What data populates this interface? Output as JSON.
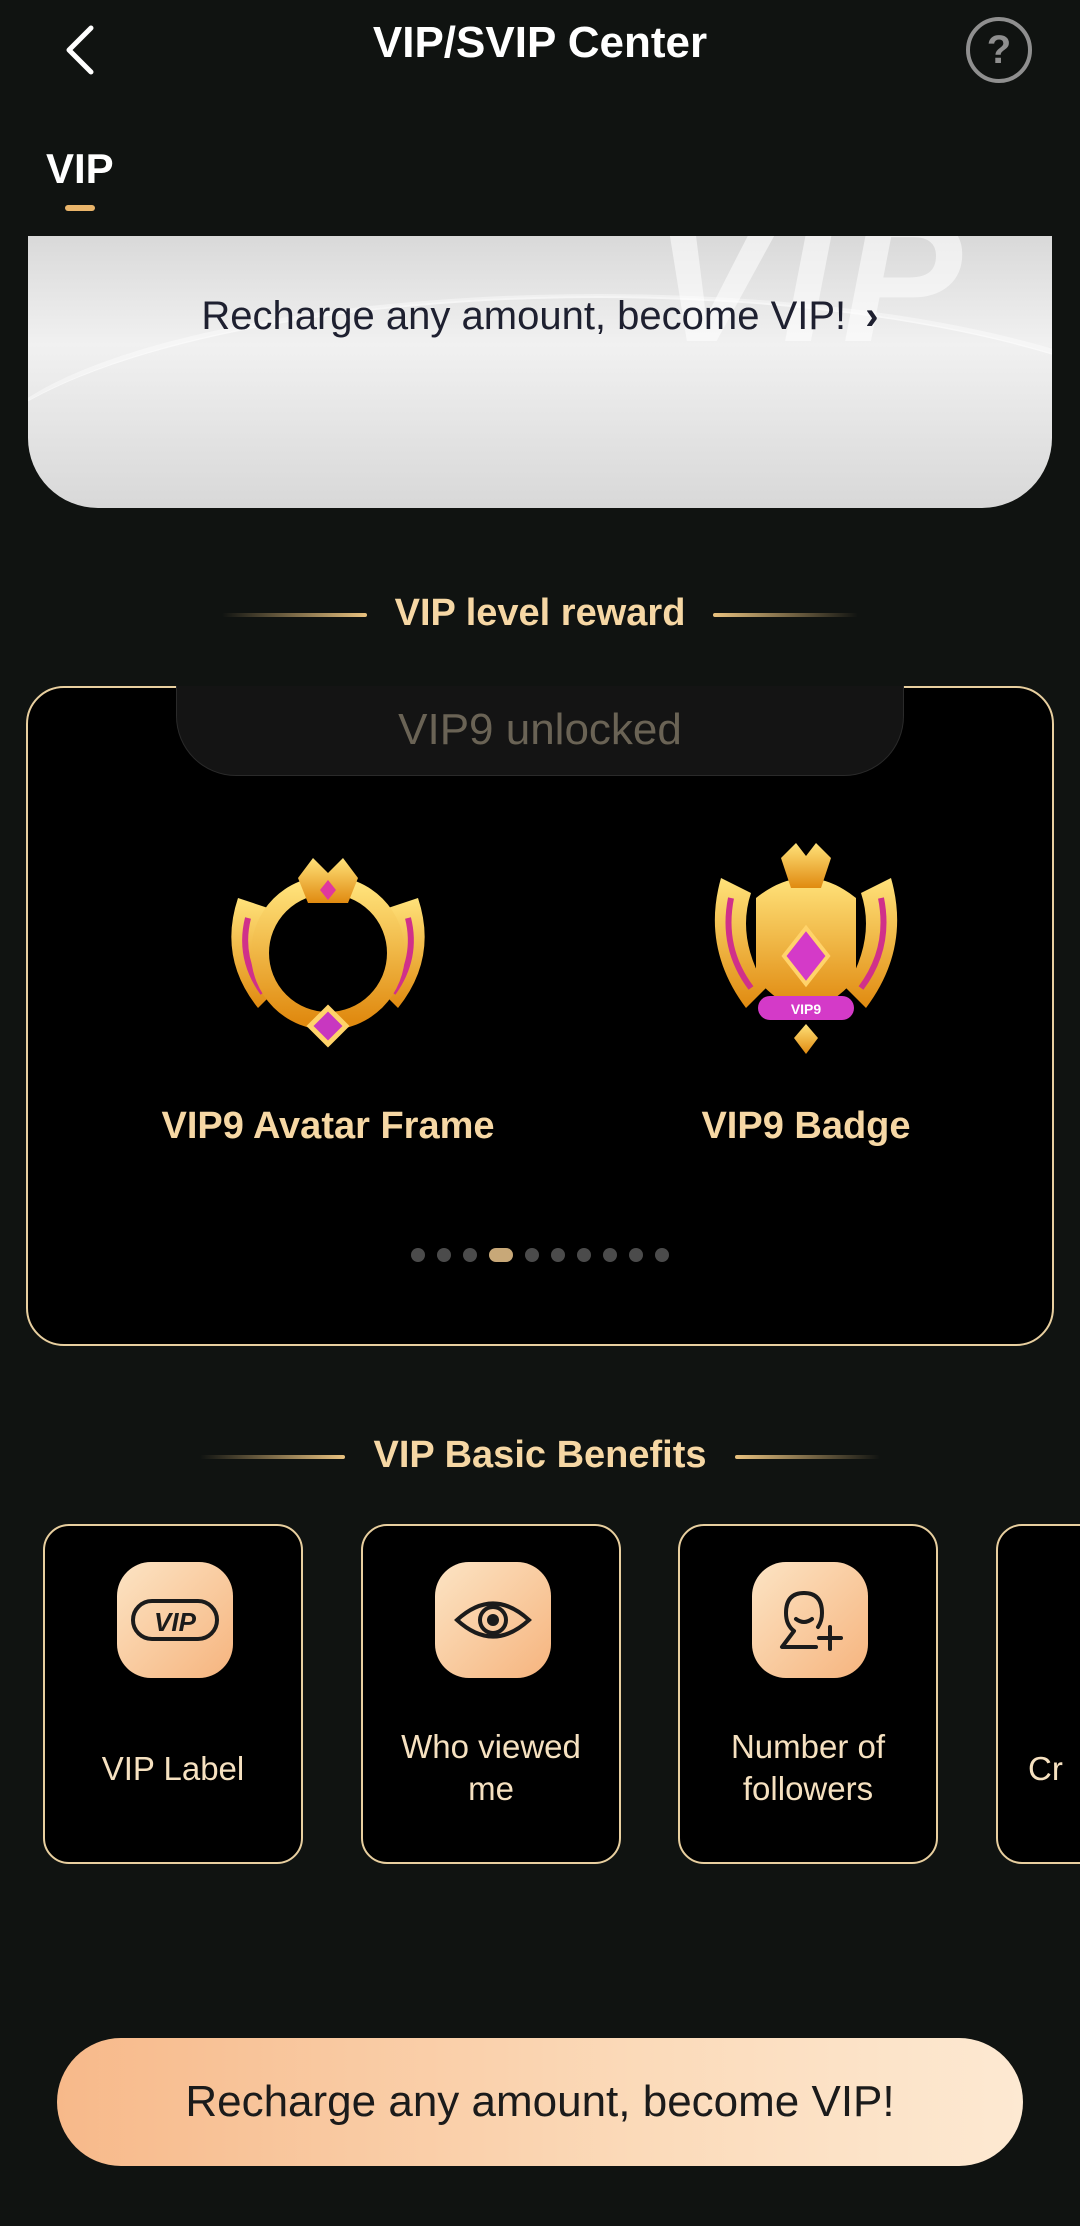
{
  "header": {
    "title": "VIP/SVIP Center",
    "help_label": "?"
  },
  "tabs": [
    {
      "label": "VIP",
      "selected": true
    }
  ],
  "banner": {
    "text": "Recharge any amount, become VIP!",
    "chevron": "›",
    "watermark": "VIP"
  },
  "level_reward": {
    "title": "VIP level reward",
    "status": "VIP9 unlocked",
    "items": [
      {
        "label": "VIP9 Avatar Frame",
        "icon": "avatar-frame-icon"
      },
      {
        "label": "VIP9 Badge",
        "icon": "badge-icon",
        "badge_text": "VIP9"
      }
    ],
    "pagination": {
      "total": 10,
      "current": 4
    }
  },
  "basic_benefits": {
    "title": "VIP Basic Benefits",
    "items": [
      {
        "label": "VIP Label",
        "icon": "vip-label-icon",
        "icon_text": "VIP"
      },
      {
        "label_line1": "Who viewed",
        "label_line2": "me",
        "icon": "eye-icon"
      },
      {
        "label_line1": "Number of",
        "label_line2": "followers",
        "icon": "add-follower-icon"
      },
      {
        "label_partial": "Cr",
        "icon": "partial-benefit-icon"
      }
    ]
  },
  "cta": {
    "label": "Recharge any amount, become VIP!"
  },
  "colors": {
    "background": "#101311",
    "gold_text": "#f6d7a4",
    "gold_border": "#e8cf9f",
    "accent": "#e9b46a"
  }
}
